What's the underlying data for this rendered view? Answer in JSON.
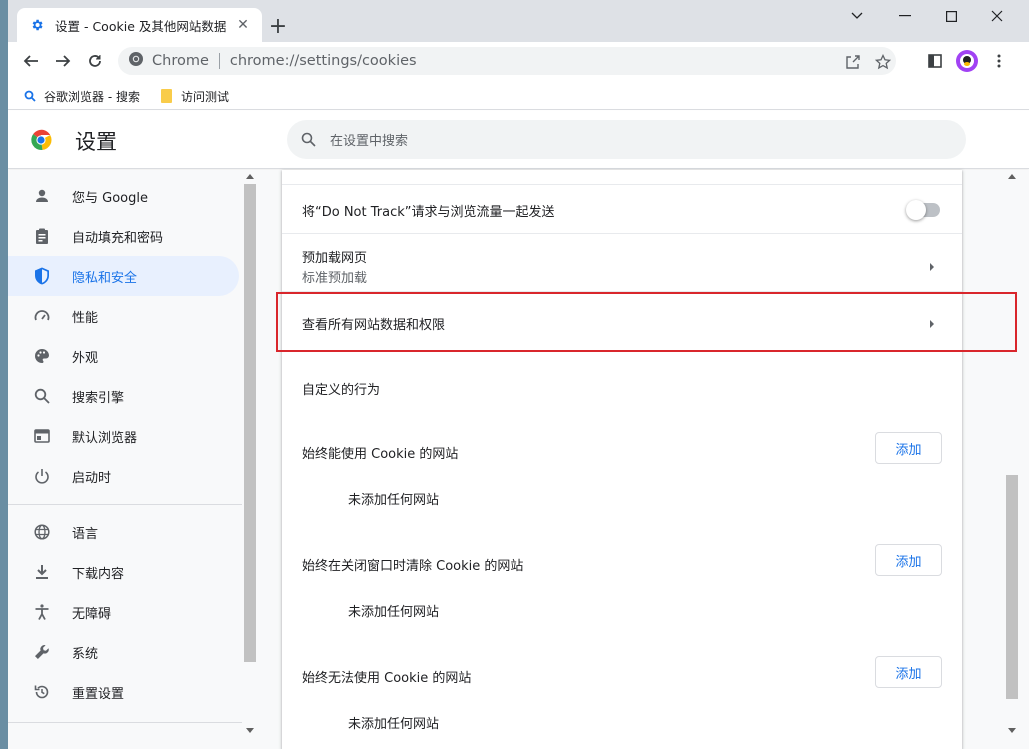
{
  "tab": {
    "title": "设置 - Cookie 及其他网站数据"
  },
  "omnibox": {
    "scheme_label": "Chrome",
    "url": "chrome://settings/cookies"
  },
  "bookmarks": [
    {
      "label": "谷歌浏览器 - 搜索",
      "icon": "search-icon"
    },
    {
      "label": "访问测试",
      "icon": "folder-icon"
    }
  ],
  "header": {
    "title": "设置",
    "search_placeholder": "在设置中搜索"
  },
  "sidebar": {
    "items": [
      {
        "label": "您与 Google",
        "icon": "person-icon"
      },
      {
        "label": "自动填充和密码",
        "icon": "clipboard-icon"
      },
      {
        "label": "隐私和安全",
        "icon": "shield-icon",
        "active": true
      },
      {
        "label": "性能",
        "icon": "gauge-icon"
      },
      {
        "label": "外观",
        "icon": "palette-icon"
      },
      {
        "label": "搜索引擎",
        "icon": "search-icon"
      },
      {
        "label": "默认浏览器",
        "icon": "browser-icon"
      },
      {
        "label": "启动时",
        "icon": "power-icon"
      },
      {
        "label": "语言",
        "icon": "globe-icon"
      },
      {
        "label": "下载内容",
        "icon": "download-icon"
      },
      {
        "label": "无障碍",
        "icon": "accessibility-icon"
      },
      {
        "label": "系统",
        "icon": "wrench-icon"
      },
      {
        "label": "重置设置",
        "icon": "reset-icon"
      }
    ]
  },
  "main": {
    "do_not_track": {
      "label": "将“Do Not Track”请求与浏览流量一起发送",
      "enabled": false
    },
    "preload": {
      "label": "预加载网页",
      "sub": "标准预加载"
    },
    "all_site_data": {
      "label": "查看所有网站数据和权限"
    },
    "custom_behaviors": {
      "heading": "自定义的行为"
    },
    "sections": [
      {
        "label": "始终能使用 Cookie 的网站",
        "button": "添加",
        "empty": "未添加任何网站"
      },
      {
        "label": "始终在关闭窗口时清除 Cookie 的网站",
        "button": "添加",
        "empty": "未添加任何网站"
      },
      {
        "label": "始终无法使用 Cookie 的网站",
        "button": "添加",
        "empty": "未添加任何网站"
      }
    ]
  },
  "colors": {
    "accent": "#1a73e8",
    "highlight": "#d9262c",
    "active_bg": "#e8f0fe"
  }
}
